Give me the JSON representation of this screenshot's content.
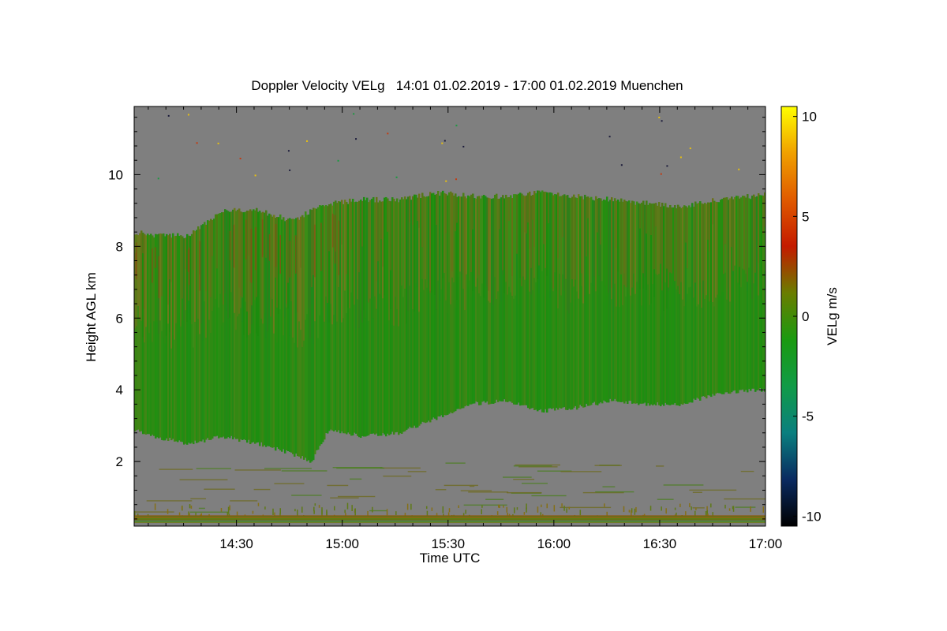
{
  "chart_data": {
    "type": "heatmap",
    "title": "Doppler Velocity VELg   14:01 01.02.2019 - 17:00 01.02.2019 Muenchen",
    "xlabel": "Time UTC",
    "ylabel": "Height AGL km",
    "x_ticks": [
      "14:30",
      "15:00",
      "15:30",
      "16:00",
      "16:30",
      "17:00"
    ],
    "x_tick_values_min": [
      870,
      900,
      930,
      960,
      990,
      1020
    ],
    "xlim_min": [
      841,
      1020
    ],
    "y_ticks": [
      "2",
      "4",
      "6",
      "8",
      "10"
    ],
    "y_tick_values": [
      2,
      4,
      6,
      8,
      10
    ],
    "ylim": [
      0.2,
      11.9
    ],
    "colorbar": {
      "label": "VELg m/s",
      "ticks": [
        "10",
        "5",
        "0",
        "-5",
        "-10"
      ],
      "tick_values": [
        10,
        5,
        0,
        -5,
        -10
      ],
      "range": [
        -10.5,
        10.5
      ],
      "colors": [
        "#000000",
        "#0a2a60",
        "#0a7f7f",
        "#119b47",
        "#1a9a10",
        "#6a7d00",
        "#c41a00",
        "#e05a00",
        "#f0a000",
        "#ffff00"
      ]
    },
    "background_color": "#7f7f7f",
    "cloud_layer": {
      "time_min": [
        841,
        846,
        856,
        866,
        876,
        886,
        891,
        896,
        906,
        916,
        926,
        936,
        946,
        956,
        966,
        976,
        986,
        996,
        1006,
        1016,
        1020
      ],
      "top_km": [
        8.4,
        8.3,
        8.3,
        9.0,
        9.0,
        8.7,
        9.0,
        9.2,
        9.3,
        9.3,
        9.5,
        9.4,
        9.4,
        9.5,
        9.4,
        9.3,
        9.2,
        9.1,
        9.3,
        9.4,
        9.5
      ],
      "base_km": [
        2.9,
        2.7,
        2.5,
        2.7,
        2.5,
        2.2,
        2.0,
        2.9,
        2.7,
        2.8,
        3.2,
        3.6,
        3.7,
        3.4,
        3.5,
        3.7,
        3.6,
        3.6,
        3.9,
        4.0,
        4.0
      ]
    },
    "surface_clutter_km": [
      0.3,
      0.5
    ],
    "grid": false
  }
}
